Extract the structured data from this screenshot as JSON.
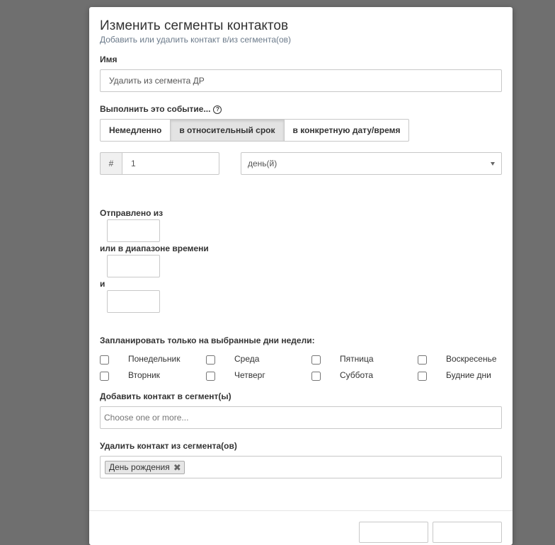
{
  "modal": {
    "title": "Изменить сегменты контактов",
    "subtitle": "Добавить или удалить контакт в/из сегмента(ов)"
  },
  "name_field": {
    "label": "Имя",
    "value": "Удалить из сегмента ДР"
  },
  "trigger": {
    "label": "Выполнить это событие...",
    "help_icon": "?",
    "options": [
      "Немедленно",
      "в относительный срок",
      "в конкретную дату/время"
    ],
    "selected": "в относительный срок"
  },
  "interval": {
    "addon": "#",
    "value": "1",
    "unit_selected": "день(й)"
  },
  "time_window": {
    "sent_from_label": "Отправлено из",
    "range_label": "или в диапазоне времени",
    "and_label": "и"
  },
  "weekdays": {
    "label": "Запланировать только на выбранные дни недели:",
    "days": [
      "Понедельник",
      "Вторник",
      "Среда",
      "Четверг",
      "Пятница",
      "Суббота",
      "Воскресенье",
      "Будние дни"
    ]
  },
  "add_segments": {
    "label": "Добавить контакт в сегмент(ы)",
    "placeholder": "Choose one or more..."
  },
  "remove_segments": {
    "label": "Удалить контакт из сегмента(ов)",
    "tags": [
      "День рождения"
    ],
    "remove_glyph": "✖"
  }
}
